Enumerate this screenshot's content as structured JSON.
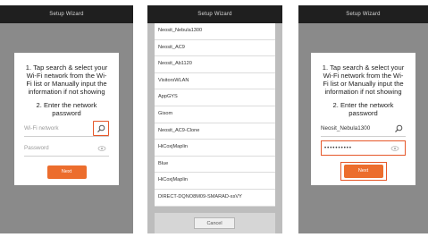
{
  "screens": [
    {
      "title": "Setup Wizard",
      "instruction_1": "1. Tap search & select your Wi-Fi network from the Wi-Fi list or Manually input the information if not showing",
      "instruction_2": "2. Enter the network password",
      "network_placeholder": "Wi-Fi network",
      "password_placeholder": "Password",
      "next_label": "Next"
    },
    {
      "title": "Setup Wizard",
      "networks": [
        "Neosit_Nebula1300",
        "Neosit_AC9",
        "Neosit_Ab1120",
        "VisitorsWLAN",
        "AppGYS",
        "Gisom",
        "Neosit_AC9-Clone",
        "HiCoxjMaplin",
        "Blue",
        "HiCoxjMaplin",
        "DIRECT-DQNO8M09-SMARAD-ssVY"
      ],
      "cancel_label": "Cancel"
    },
    {
      "title": "Setup Wizard",
      "instruction_1": "1. Tap search & select your Wi-Fi network from the Wi-Fi list or Manually input the information if not showing",
      "instruction_2": "2. Enter the network password",
      "network_value": "Neosit_Nebula1300",
      "password_value": "••••••••••",
      "next_label": "Next"
    }
  ],
  "colors": {
    "accent": "#ec6d2d",
    "highlight": "#e6582a",
    "overlay": "#8a8a8a",
    "topbar": "#1f1f1f"
  }
}
